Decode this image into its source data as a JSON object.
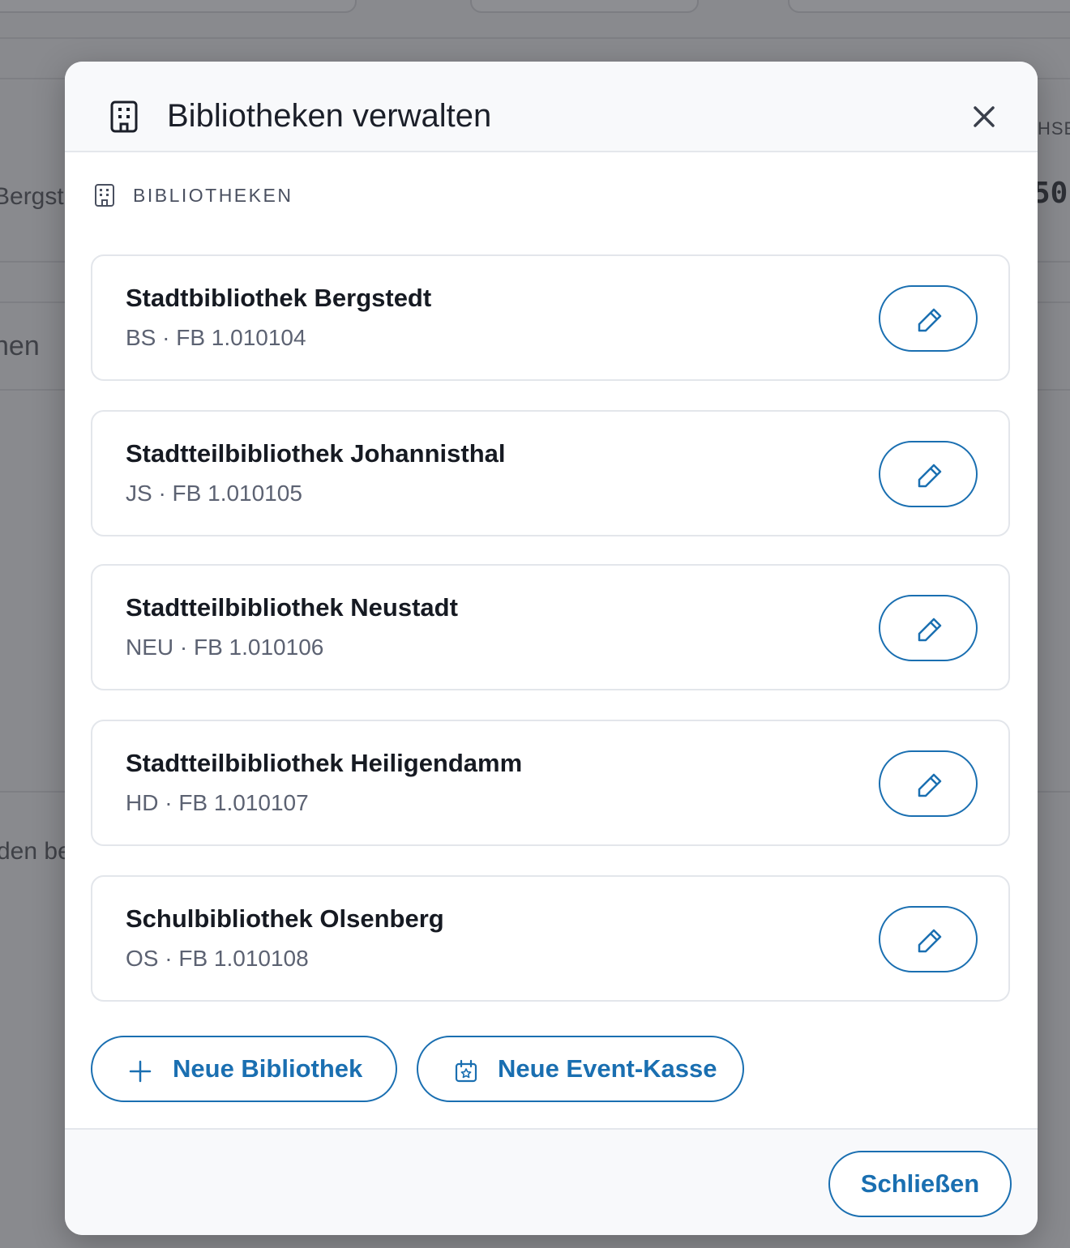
{
  "background": {
    "fragments": [
      "Bergste",
      "nen",
      "den be",
      "HSE",
      "50,"
    ]
  },
  "modal": {
    "title": "Bibliotheken verwalten",
    "header_icon": "building-icon",
    "close_icon": "close-icon",
    "section_label": "BIBLIOTHEKEN",
    "libraries": [
      {
        "name": "Stadtbibliothek Bergstedt",
        "meta": "BS · FB 1.010104"
      },
      {
        "name": "Stadtteilbibliothek Johannisthal",
        "meta": "JS · FB 1.010105"
      },
      {
        "name": "Stadtteilbibliothek Neustadt",
        "meta": "NEU · FB 1.010106"
      },
      {
        "name": "Stadtteilbibliothek Heiligendamm",
        "meta": "HD · FB 1.010107"
      },
      {
        "name": "Schulbibliothek Olsenberg",
        "meta": "OS · FB 1.010108"
      }
    ],
    "actions": {
      "new_library": "Neue Bibliothek",
      "new_event_register": "Neue Event-Kasse"
    },
    "footer": {
      "close_label": "Schließen"
    }
  },
  "colors": {
    "accent": "#1a6fb1",
    "overlay": "#898a8e",
    "text": "#161a22",
    "muted": "#5c6272"
  }
}
